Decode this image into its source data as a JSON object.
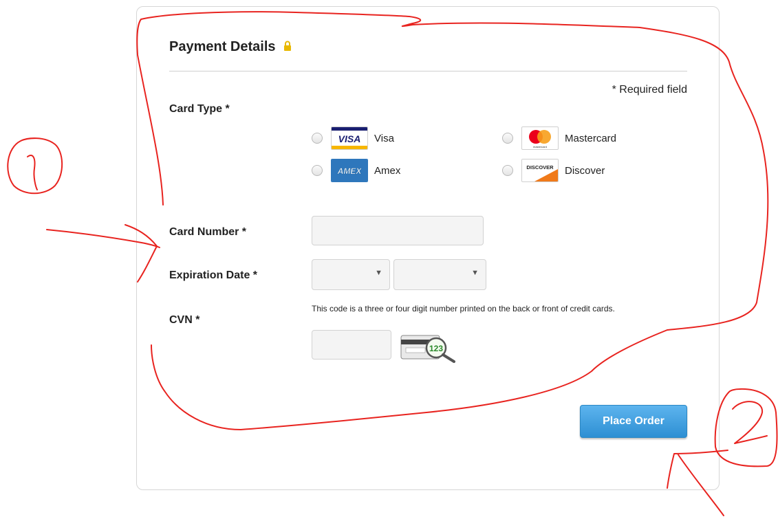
{
  "form": {
    "title": "Payment Details",
    "required_note": "* Required field",
    "labels": {
      "card_type": "Card Type *",
      "card_number": "Card Number *",
      "expiration": "Expiration Date *",
      "cvn": "CVN *"
    },
    "card_types": [
      {
        "name": "Visa",
        "logo_text": "VISA"
      },
      {
        "name": "Mastercard",
        "logo_text": "mastercard"
      },
      {
        "name": "Amex",
        "logo_text": "AMEX"
      },
      {
        "name": "Discover",
        "logo_text": "DISCOVER"
      }
    ],
    "card_number_value": "",
    "expiration": {
      "month_value": "",
      "year_value": ""
    },
    "cvn_hint": "This code is a three or four digit number printed on the back or front of credit cards.",
    "cvn_value": "",
    "cvn_image_digits": "123",
    "place_order_label": "Place Order"
  },
  "annotations": {
    "mark_1": "1",
    "mark_2": "2"
  },
  "colors": {
    "accent_button": "#2d8fd3",
    "annotation_red": "#e8231f",
    "lock": "#e8b800",
    "visa_blue": "#1a1f71",
    "amex_blue": "#2e77bc"
  },
  "icons": [
    "lock-icon",
    "visa-logo-icon",
    "mastercard-logo-icon",
    "amex-logo-icon",
    "discover-logo-icon",
    "cvn-card-icon",
    "caret-down-icon"
  ]
}
